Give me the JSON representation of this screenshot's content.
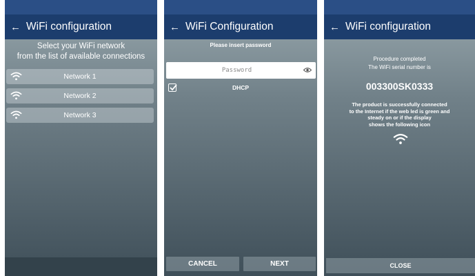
{
  "screen_select": {
    "title": "WiFi configuration",
    "instructions": [
      "Select your WiFi network",
      "from the list of available connections"
    ],
    "networks": [
      {
        "name": "Network 1",
        "icon": "wifi-icon"
      },
      {
        "name": "Network 2",
        "icon": "wifi-icon"
      },
      {
        "name": "Network 3",
        "icon": "wifi-icon"
      }
    ]
  },
  "screen_password": {
    "title": "WiFi Configuration",
    "prompt": "Please insert password",
    "password_placeholder": "Password",
    "password_value": "",
    "dhcp_label": "DHCP",
    "dhcp_checked": true,
    "cancel_label": "CANCEL",
    "next_label": "NEXT"
  },
  "screen_done": {
    "title": "WiFi configuration",
    "procedure_lines": [
      "Procedure completed",
      "The WiFi serial number is"
    ],
    "serial_number": "003300SK0333",
    "success_lines": [
      "The product is successfully connected",
      "to the Internet if the web led is green and",
      "steady on or if the display",
      "shows the following icon"
    ],
    "close_label": "CLOSE"
  },
  "colors": {
    "status_bar": "#2b4f86",
    "app_bar": "#1c3d6d",
    "background_top": "#99a8ae",
    "background_bottom": "#3f4f59"
  }
}
